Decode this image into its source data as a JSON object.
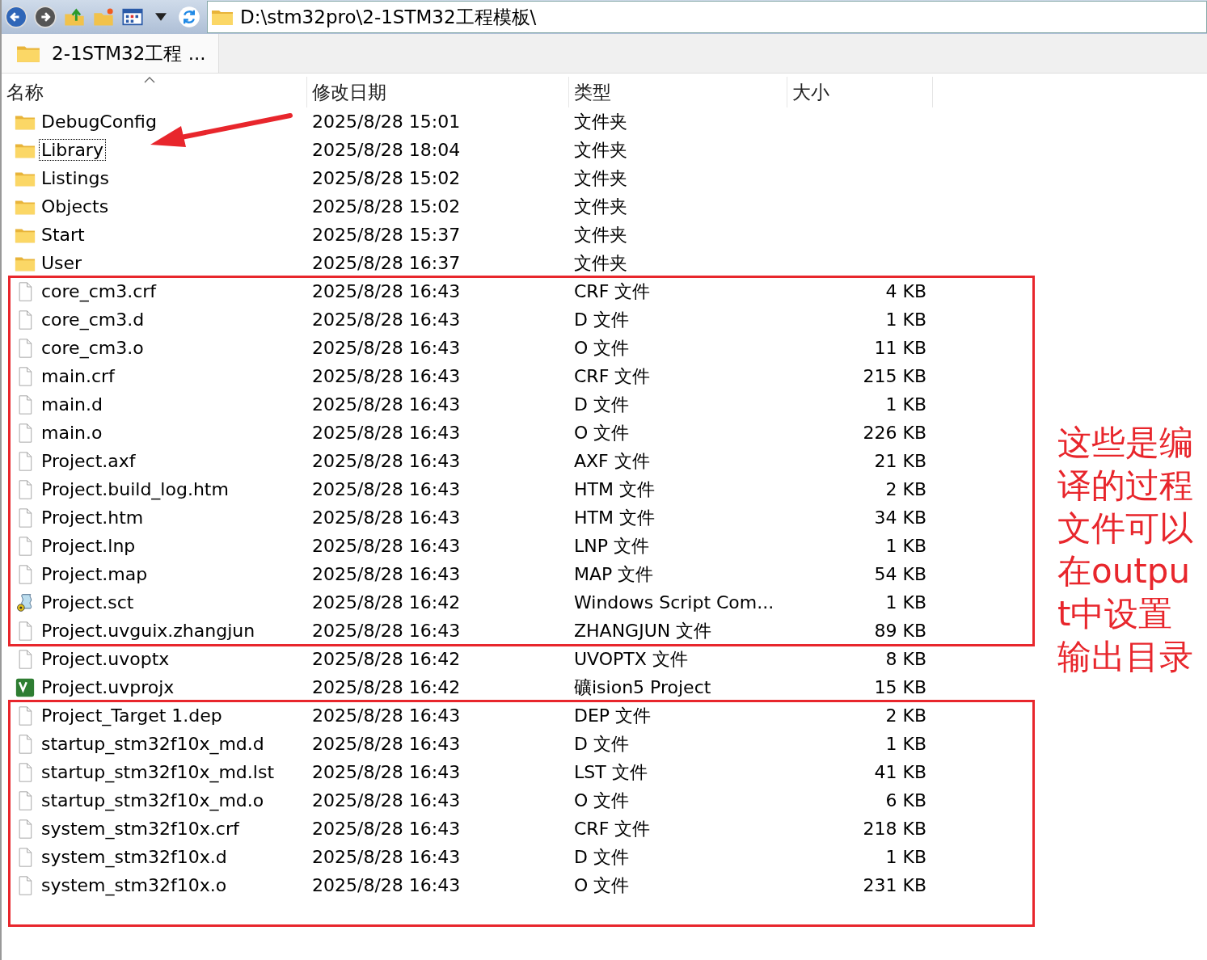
{
  "toolbar": {
    "address": "D:\\stm32pro\\2-1STM32工程模板\\"
  },
  "tab": {
    "label": "2-1STM32工程 ..."
  },
  "columns": [
    {
      "label": "名称",
      "sorted": true
    },
    {
      "label": "修改日期",
      "sorted": false
    },
    {
      "label": "类型",
      "sorted": false
    },
    {
      "label": "大小",
      "sorted": false
    }
  ],
  "sections": [
    {
      "boxed": false,
      "rows": [
        {
          "kind": "folder",
          "name": "DebugConfig",
          "date": "2025/8/28 15:01",
          "type": "文件夹",
          "focused": false
        },
        {
          "kind": "folder",
          "name": "Library",
          "date": "2025/8/28 18:04",
          "type": "文件夹",
          "focused": true
        },
        {
          "kind": "folder",
          "name": "Listings",
          "date": "2025/8/28 15:02",
          "type": "文件夹",
          "focused": false
        },
        {
          "kind": "folder",
          "name": "Objects",
          "date": "2025/8/28 15:02",
          "type": "文件夹",
          "focused": false
        },
        {
          "kind": "folder",
          "name": "Start",
          "date": "2025/8/28 15:37",
          "type": "文件夹",
          "focused": false
        },
        {
          "kind": "folder",
          "name": "User",
          "date": "2025/8/28 16:37",
          "type": "文件夹",
          "focused": false
        }
      ]
    },
    {
      "boxed": true,
      "rows": [
        {
          "kind": "file",
          "name": "core_cm3.crf",
          "date": "2025/8/28 16:43",
          "type": "CRF 文件",
          "size": "4 KB",
          "focused": false
        },
        {
          "kind": "file",
          "name": "core_cm3.d",
          "date": "2025/8/28 16:43",
          "type": "D 文件",
          "size": "1 KB",
          "focused": false
        },
        {
          "kind": "file",
          "name": "core_cm3.o",
          "date": "2025/8/28 16:43",
          "type": "O 文件",
          "size": "11 KB",
          "focused": false
        },
        {
          "kind": "file",
          "name": "main.crf",
          "date": "2025/8/28 16:43",
          "type": "CRF 文件",
          "size": "215 KB",
          "focused": false
        },
        {
          "kind": "file",
          "name": "main.d",
          "date": "2025/8/28 16:43",
          "type": "D 文件",
          "size": "1 KB",
          "focused": false
        },
        {
          "kind": "file",
          "name": "main.o",
          "date": "2025/8/28 16:43",
          "type": "O 文件",
          "size": "226 KB",
          "focused": false
        },
        {
          "kind": "file",
          "name": "Project.axf",
          "date": "2025/8/28 16:43",
          "type": "AXF 文件",
          "size": "21 KB",
          "focused": false
        },
        {
          "kind": "file",
          "name": "Project.build_log.htm",
          "date": "2025/8/28 16:43",
          "type": "HTM 文件",
          "size": "2 KB",
          "focused": false
        },
        {
          "kind": "file",
          "name": "Project.htm",
          "date": "2025/8/28 16:43",
          "type": "HTM 文件",
          "size": "34 KB",
          "focused": false
        },
        {
          "kind": "file",
          "name": "Project.lnp",
          "date": "2025/8/28 16:43",
          "type": "LNP 文件",
          "size": "1 KB",
          "focused": false
        },
        {
          "kind": "file",
          "name": "Project.map",
          "date": "2025/8/28 16:43",
          "type": "MAP 文件",
          "size": "54 KB",
          "focused": false
        },
        {
          "kind": "script",
          "name": "Project.sct",
          "date": "2025/8/28 16:42",
          "type": "Windows Script Com...",
          "size": "1 KB",
          "focused": false
        },
        {
          "kind": "file",
          "name": "Project.uvguix.zhangjun",
          "date": "2025/8/28 16:43",
          "type": "ZHANGJUN 文件",
          "size": "89 KB",
          "focused": false
        }
      ]
    },
    {
      "boxed": false,
      "rows": [
        {
          "kind": "file",
          "name": "Project.uvoptx",
          "date": "2025/8/28 16:42",
          "type": "UVOPTX 文件",
          "size": "8 KB",
          "focused": false
        },
        {
          "kind": "project",
          "name": "Project.uvprojx",
          "date": "2025/8/28 16:42",
          "type": "礦ision5 Project",
          "size": "15 KB",
          "focused": false
        }
      ]
    },
    {
      "boxed": true,
      "rows": [
        {
          "kind": "file",
          "name": "Project_Target 1.dep",
          "date": "2025/8/28 16:43",
          "type": "DEP 文件",
          "size": "2 KB",
          "focused": false
        },
        {
          "kind": "file",
          "name": "startup_stm32f10x_md.d",
          "date": "2025/8/28 16:43",
          "type": "D 文件",
          "size": "1 KB",
          "focused": false
        },
        {
          "kind": "file",
          "name": "startup_stm32f10x_md.lst",
          "date": "2025/8/28 16:43",
          "type": "LST 文件",
          "size": "41 KB",
          "focused": false
        },
        {
          "kind": "file",
          "name": "startup_stm32f10x_md.o",
          "date": "2025/8/28 16:43",
          "type": "O 文件",
          "size": "6 KB",
          "focused": false
        },
        {
          "kind": "file",
          "name": "system_stm32f10x.crf",
          "date": "2025/8/28 16:43",
          "type": "CRF 文件",
          "size": "218 KB",
          "focused": false
        },
        {
          "kind": "file",
          "name": "system_stm32f10x.d",
          "date": "2025/8/28 16:43",
          "type": "D 文件",
          "size": "1 KB",
          "focused": false
        },
        {
          "kind": "file",
          "name": "system_stm32f10x.o",
          "date": "2025/8/28 16:43",
          "type": "O 文件",
          "size": "231 KB",
          "focused": false
        }
      ]
    }
  ],
  "annotation": {
    "note": "这些是编译的过程文件可以在output中设置输出目录"
  }
}
